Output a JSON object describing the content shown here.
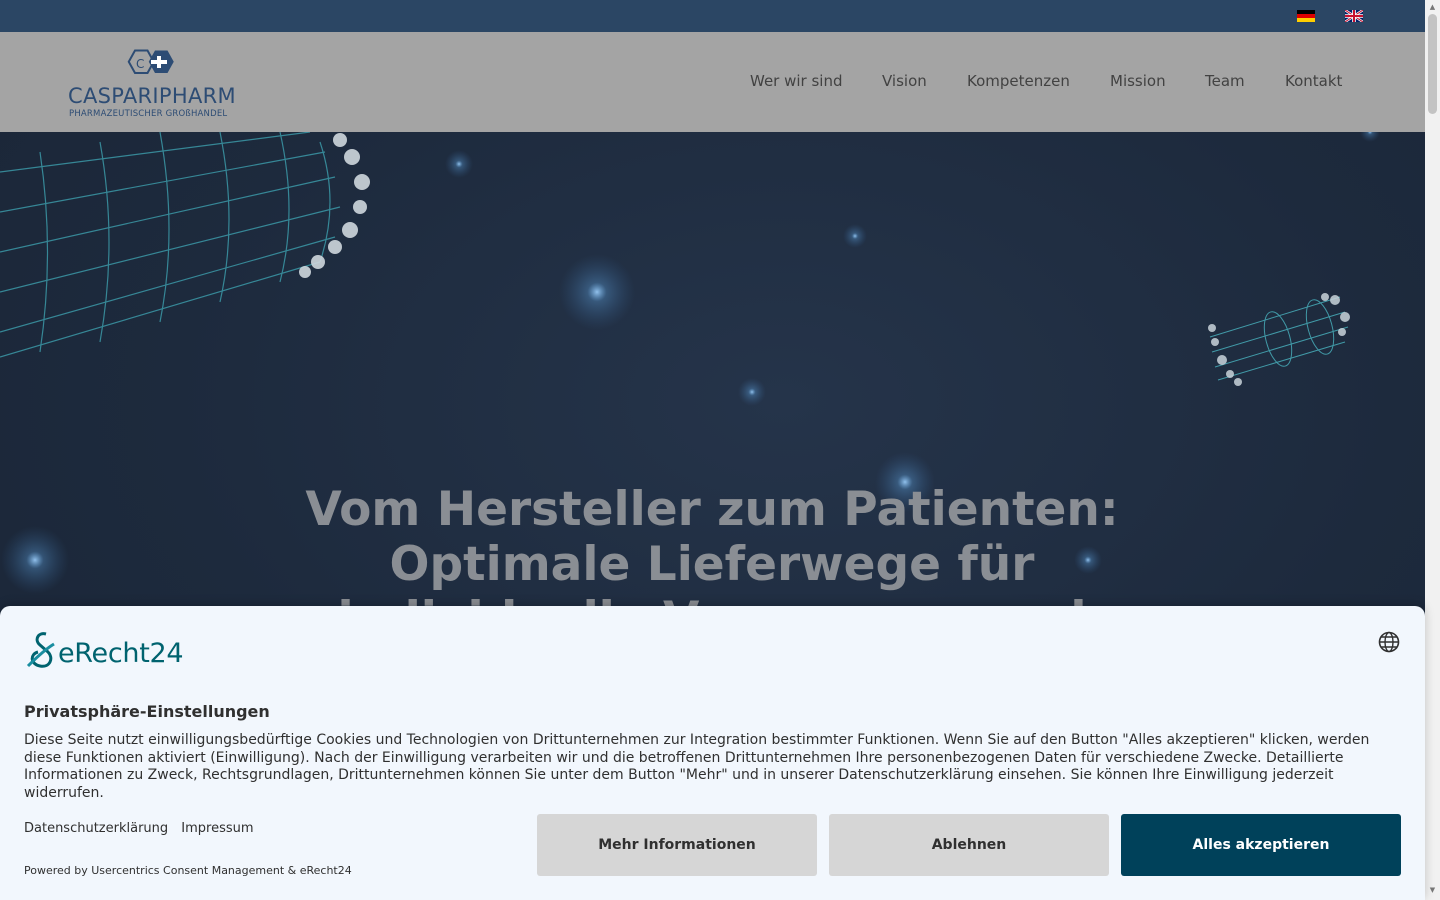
{
  "topbar": {
    "languages": [
      {
        "name": "de-flag-icon"
      },
      {
        "name": "gb-flag-icon"
      }
    ]
  },
  "header": {
    "logo": {
      "name": "CASPARIPHARM",
      "subtitle": "PHARMAZEUTISCHER GROßHANDEL"
    },
    "nav": [
      "Wer wir sind",
      "Vision",
      "Kompetenzen",
      "Mission",
      "Team",
      "Kontakt"
    ]
  },
  "hero": {
    "title_lines": [
      "Vom Hersteller zum Patienten:",
      "Optimale Lieferwege für",
      "individuelle Versorgung und"
    ]
  },
  "consent": {
    "brand": "eRecht24",
    "title": "Privatsphäre-Einstellungen",
    "text": "Diese Seite nutzt einwilligungsbedürftige Cookies und Technologien von Drittunternehmen zur Integration bestimmter Funktionen. Wenn Sie auf den Button \"Alles akzeptieren\" klicken, werden diese Funktionen aktiviert (Einwilligung). Nach der Einwilligung verarbeiten wir und die betroffenen Drittunternehmen Ihre personenbezogenen Daten für verschiedene Zwecke. Detaillierte Informationen zu Zweck, Rechtsgrundlagen, Drittunternehmen können Sie unter dem Button \"Mehr\" und in unserer Datenschutzerklärung einsehen. Sie können Ihre Einwilligung jederzeit widerrufen.",
    "links": {
      "privacy": "Datenschutzerklärung",
      "imprint": "Impressum"
    },
    "powered_by": "Powered by Usercentrics Consent Management & eRecht24",
    "buttons": {
      "more": "Mehr Informationen",
      "deny": "Ablehnen",
      "accept": "Alles akzeptieren"
    },
    "colors": {
      "accept_bg": "#00415a",
      "secondary_bg": "#d6d6d6",
      "brand": "#00636f"
    }
  }
}
